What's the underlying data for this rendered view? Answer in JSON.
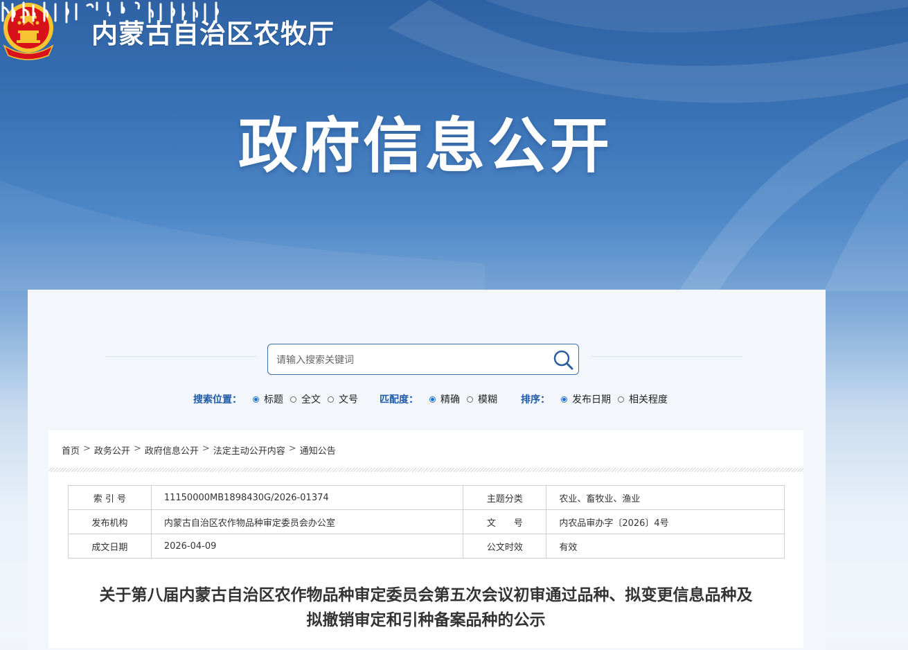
{
  "site": {
    "name": "内蒙古自治区农牧厅",
    "banner_title": "政府信息公开"
  },
  "search": {
    "placeholder": "请输入搜索关键词",
    "value": ""
  },
  "options": {
    "position": {
      "label": "搜索位置：",
      "choices": [
        "标题",
        "全文",
        "文号"
      ],
      "selected": "标题"
    },
    "match": {
      "label": "匹配度：",
      "choices": [
        "精确",
        "模糊"
      ],
      "selected": "精确"
    },
    "sort": {
      "label": "排序：",
      "choices": [
        "发布日期",
        "相关程度"
      ],
      "selected": "发布日期"
    }
  },
  "breadcrumb": [
    "首页",
    "政务公开",
    "政府信息公开",
    "法定主动公开内容",
    "通知公告"
  ],
  "breadcrumb_separator": ">",
  "meta": {
    "index_label": "索 引 号",
    "index_value": "11150000MB1898430G/2026-01374",
    "topic_label": "主题分类",
    "topic_value": "农业、畜牧业、渔业",
    "publisher_label": "发布机构",
    "publisher_value": "内蒙古自治区农作物品种审定委员会办公室",
    "docno_label": "文　　号",
    "docno_value": "内农品审办字〔2026〕4号",
    "date_label": "成文日期",
    "date_value": "2026-04-09",
    "validity_label": "公文时效",
    "validity_value": "有效"
  },
  "document": {
    "title_line1": "关于第八届内蒙古自治区农作物品种审定委员会第五次会议初审通过品种、拟变更信息品种及",
    "title_line2": "拟撤销审定和引种备案品种的公示"
  },
  "colors": {
    "banner_top": "#2e62a4",
    "accent": "#1f5aa6",
    "radio": "#1a6fd1",
    "emblem_red": "#d8121b",
    "emblem_gold": "#f6c531"
  },
  "icons": [
    "national-emblem-icon",
    "mongolian-script-logo",
    "search-icon"
  ]
}
